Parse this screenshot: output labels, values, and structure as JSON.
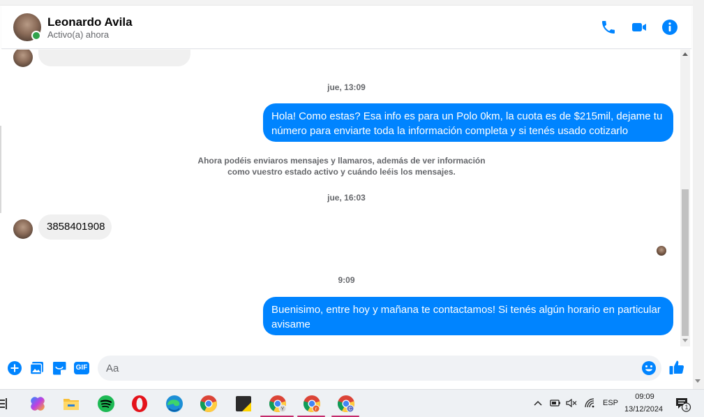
{
  "header": {
    "contact_name": "Leonardo Avila",
    "status": "Activo(a) ahora",
    "icons": [
      "phone-icon",
      "video-camera-icon",
      "info-icon"
    ],
    "accent_color": "#0084ff"
  },
  "messages": {
    "timestamp_1": "jue, 13:09",
    "outgoing_1": "Hola! Como estas? Esa info es para un Polo 0km, la cuota es de $215mil, dejame tu número para enviarte toda la información completa y si tenés usado cotizarlo",
    "system_note": "Ahora podéis enviaros mensajes y llamaros, además de ver información como vuestro estado activo y cuándo leéis los mensajes.",
    "timestamp_2": "jue, 16:03",
    "incoming_1": "3858401908",
    "timestamp_3": "9:09",
    "outgoing_2": "Buenisimo, entre hoy y mañana te contactamos! Si tenés algún horario en particular avisame"
  },
  "composer": {
    "placeholder": "Aa",
    "icons": [
      "plus-icon",
      "image-icon",
      "sticker-icon",
      "gif-icon",
      "emoji-icon",
      "thumbs-up-icon"
    ],
    "gif_label": "GIF"
  },
  "taskbar": {
    "apps": [
      "copilot-icon",
      "file-explorer-icon",
      "spotify-icon",
      "opera-icon",
      "edge-icon",
      "chrome-icon",
      "notes-icon",
      "chrome-profile-y-icon",
      "chrome-profile-r-icon",
      "chrome-profile-c-icon"
    ],
    "language": "ESP",
    "time": "09:09",
    "date": "13/12/2024",
    "notification_count": "1"
  }
}
